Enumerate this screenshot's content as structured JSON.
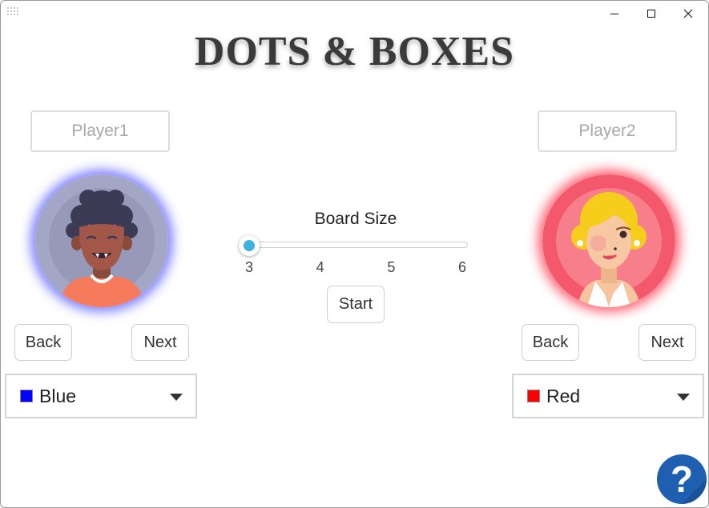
{
  "window": {
    "controls": {
      "minimize": "minimize-icon",
      "maximize": "maximize-icon",
      "close": "close-icon"
    }
  },
  "title": "DOTS & BOXES",
  "player1": {
    "name_placeholder": "Player1",
    "name_value": "",
    "avatar_icon": "avatar-boy-icon",
    "glow_color": "#6a6cff",
    "back_label": "Back",
    "next_label": "Next",
    "color_label": "Blue",
    "color_swatch": "#0000ff"
  },
  "player2": {
    "name_placeholder": "Player2",
    "name_value": "",
    "avatar_icon": "avatar-woman-icon",
    "glow_color": "#ff4d5e",
    "back_label": "Back",
    "next_label": "Next",
    "color_label": "Red",
    "color_swatch": "#ff0000"
  },
  "board": {
    "label": "Board Size",
    "ticks": [
      "3",
      "4",
      "5",
      "6"
    ],
    "min": 3,
    "max": 6,
    "value": 3,
    "accent": "#3cb3e3"
  },
  "start_label": "Start",
  "help_icon": "help-icon"
}
